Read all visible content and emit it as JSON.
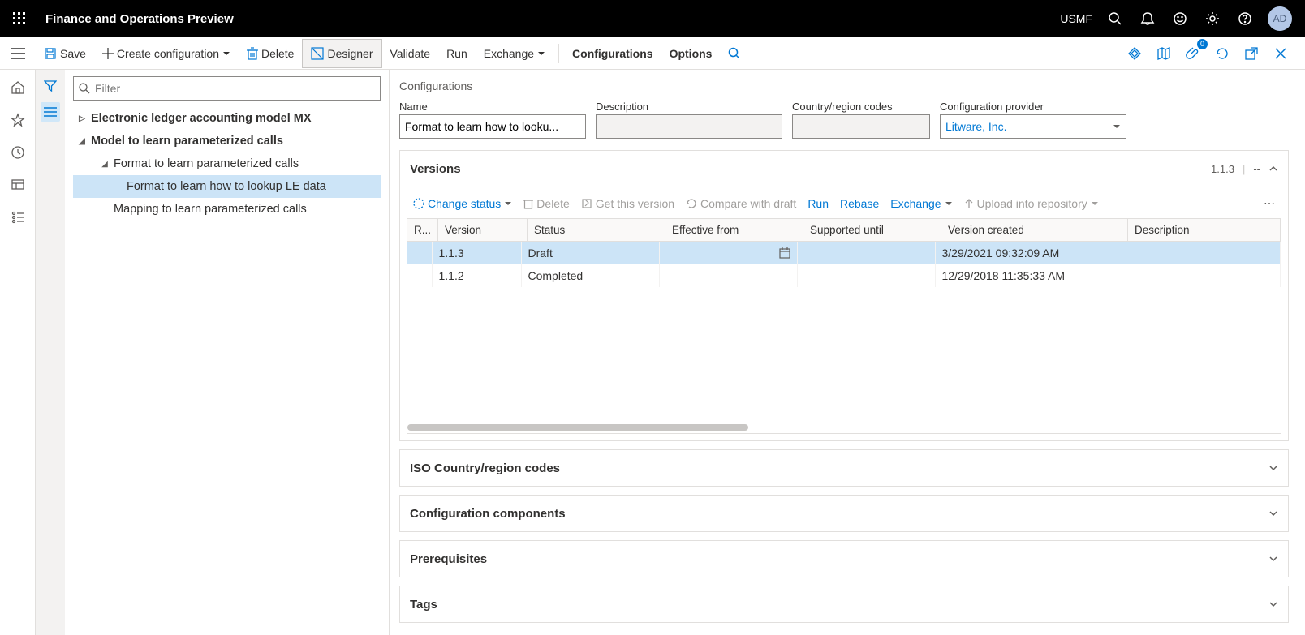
{
  "header": {
    "app_title": "Finance and Operations Preview",
    "company": "USMF",
    "avatar": "AD"
  },
  "actions": {
    "save": "Save",
    "create": "Create configuration",
    "delete": "Delete",
    "designer": "Designer",
    "validate": "Validate",
    "run": "Run",
    "exchange": "Exchange",
    "configurations": "Configurations",
    "options": "Options",
    "badge_count": "0"
  },
  "tree": {
    "filter_placeholder": "Filter",
    "items": [
      "Electronic ledger accounting model MX",
      "Model to learn parameterized calls",
      "Format to learn parameterized calls",
      "Format to learn how to lookup LE data",
      "Mapping to learn parameterized calls"
    ]
  },
  "config": {
    "section": "Configurations",
    "labels": {
      "name": "Name",
      "desc": "Description",
      "country": "Country/region codes",
      "provider": "Configuration provider"
    },
    "name": "Format to learn how to looku...",
    "desc": "",
    "country": "",
    "provider": "Litware, Inc."
  },
  "versions": {
    "title": "Versions",
    "current": "1.1.3",
    "dash": "--",
    "toolbar": {
      "change_status": "Change status",
      "delete": "Delete",
      "get": "Get this version",
      "compare": "Compare with draft",
      "run": "Run",
      "rebase": "Rebase",
      "exchange": "Exchange",
      "upload": "Upload into repository"
    },
    "columns": [
      "R...",
      "Version",
      "Status",
      "Effective from",
      "Supported until",
      "Version created",
      "Description"
    ],
    "rows": [
      {
        "r": "",
        "version": "1.1.3",
        "status": "Draft",
        "eff": "",
        "sup": "",
        "created": "3/29/2021 09:32:09 AM",
        "desc": ""
      },
      {
        "r": "",
        "version": "1.1.2",
        "status": "Completed",
        "eff": "",
        "sup": "",
        "created": "12/29/2018 11:35:33 AM",
        "desc": ""
      }
    ]
  },
  "panels": {
    "iso": "ISO Country/region codes",
    "components": "Configuration components",
    "prereq": "Prerequisites",
    "tags": "Tags"
  }
}
